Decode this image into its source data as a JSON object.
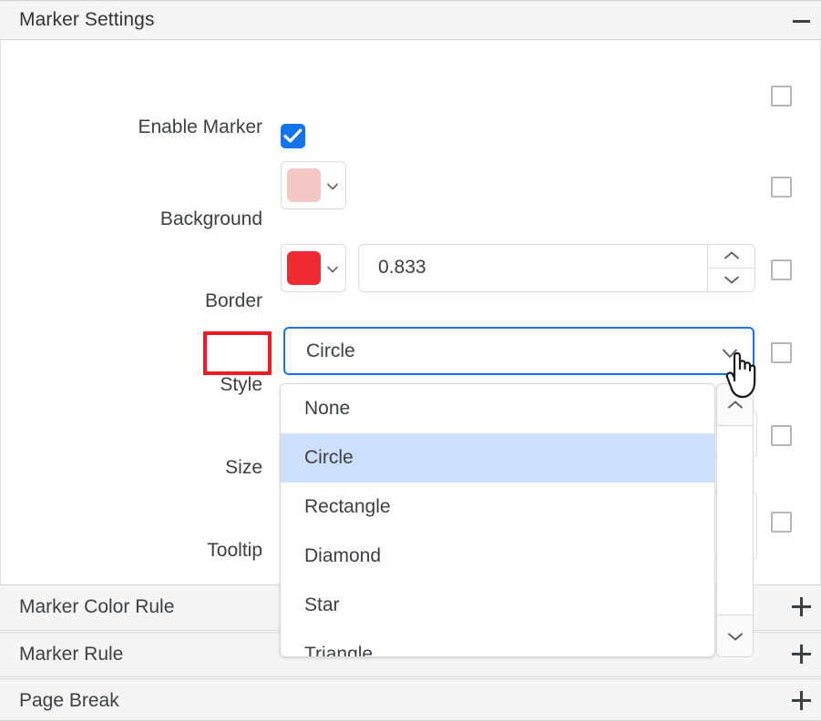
{
  "panel": {
    "title": "Marker Settings",
    "collapse_icon": "minus-icon"
  },
  "rows": {
    "enable_marker": {
      "label": "Enable Marker",
      "checkbox_checked": true,
      "checkbox_icon": "checkmark-icon"
    },
    "background": {
      "label": "Background",
      "swatch_color": "#f5c6c6",
      "caret_icon": "chevron-down-icon"
    },
    "border": {
      "label": "Border",
      "swatch_color": "#f02a32",
      "caret_icon": "chevron-down-icon",
      "width_value": "0.833",
      "spinner_up_icon": "chevron-up-icon",
      "spinner_down_icon": "chevron-down-icon"
    },
    "style": {
      "label": "Style",
      "value": "Circle",
      "caret_icon": "chevron-down-icon",
      "highlight_color": "#ed1c24"
    },
    "size": {
      "label": "Size"
    },
    "tooltip": {
      "label": "Tooltip"
    }
  },
  "override_checkboxes": [
    {
      "name": "enable-marker"
    },
    {
      "name": "background"
    },
    {
      "name": "border"
    },
    {
      "name": "style"
    },
    {
      "name": "size"
    },
    {
      "name": "tooltip"
    }
  ],
  "dropdown": {
    "open": true,
    "selected": "Circle",
    "options": [
      {
        "label": "None",
        "selected": false
      },
      {
        "label": "Circle",
        "selected": true
      },
      {
        "label": "Rectangle",
        "selected": false
      },
      {
        "label": "Diamond",
        "selected": false
      },
      {
        "label": "Star",
        "selected": false
      },
      {
        "label": "Triangle",
        "selected": false
      }
    ],
    "scroll_up_icon": "chevron-up-icon",
    "scroll_down_icon": "chevron-down-icon",
    "highlight_color": "#cddffb"
  },
  "accordions": [
    {
      "label": "Marker Color Rule",
      "expand_icon": "plus-icon"
    },
    {
      "label": "Marker Rule",
      "expand_icon": "plus-icon"
    },
    {
      "label": "Page Break",
      "expand_icon": "plus-icon"
    }
  ],
  "cursor": {
    "type": "pointing-hand-cursor"
  },
  "colors": {
    "accent_blue": "#1a73e8",
    "checkbox_blue": "#1273eb",
    "annotation_red": "#ed1c24",
    "header_bg": "#f5f5f5"
  }
}
